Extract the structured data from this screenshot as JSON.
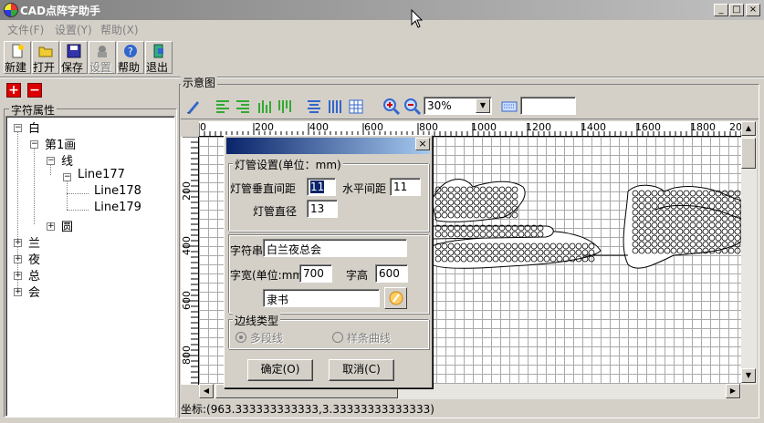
{
  "window": {
    "title": "CAD点阵字助手",
    "minimize": "_",
    "maximize": "□",
    "close": "×"
  },
  "menu": {
    "file": "文件(F)",
    "settings": "设置(Y)",
    "help": "帮助(X)"
  },
  "toolbar": {
    "new": "新建",
    "open": "打开",
    "save": "保存",
    "settings": "设置",
    "help": "帮助",
    "exit": "退出"
  },
  "left_panel": {
    "add_button": "+",
    "remove_button": "−",
    "group_title": "字符属性",
    "tree": {
      "char1": "白",
      "stroke1": "第1画",
      "line": "线",
      "line177": "Line177",
      "line178": "Line178",
      "line179": "Line179",
      "circle": "圆",
      "char2": "兰",
      "char3": "夜",
      "char4": "总",
      "char5": "会"
    }
  },
  "preview": {
    "title": "示意图",
    "zoom": "30%",
    "ruler_h": [
      "0",
      "200",
      "400",
      "600",
      "800",
      "1000",
      "1200",
      "1400",
      "1600",
      "1800",
      "20"
    ],
    "ruler_v": [
      "200",
      "400",
      "600",
      "800"
    ]
  },
  "status": {
    "coords": "坐标:(963.333333333333,3.33333333333333)"
  },
  "dialog": {
    "close": "×",
    "lamp_group": "灯管设置(单位：mm)",
    "vertical_spacing_label": "灯管垂直间距",
    "vertical_spacing": "11",
    "horizontal_spacing_label": "水平间距",
    "horizontal_spacing": "11",
    "diameter_label": "灯管直径",
    "diameter": "13",
    "string_label": "字符串",
    "string_value": "白兰夜总会",
    "width_label": "字宽(单位:mm)",
    "width_value": "700",
    "height_label": "字高",
    "height_value": "600",
    "font_value": "隶书",
    "border_group": "边线类型",
    "polyline": "多段线",
    "spline": "样条曲线",
    "ok": "确定(O)",
    "cancel": "取消(C)"
  },
  "colors": {
    "dialog_title_start": "#0a246a",
    "dialog_title_end": "#a6caf0",
    "remove_red": "#d00000"
  }
}
